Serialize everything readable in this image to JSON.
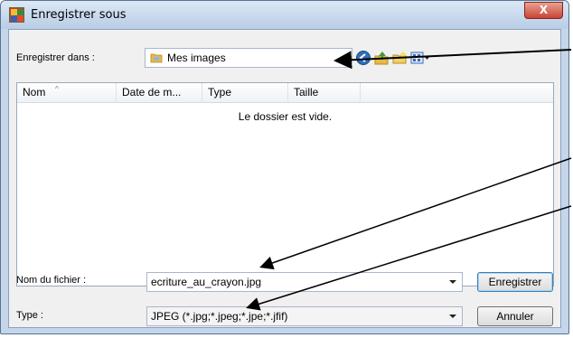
{
  "window": {
    "title": "Enregistrer sous",
    "close_label": "X"
  },
  "toolbar": {
    "save_in_label": "Enregistrer dans :",
    "location_value": "Mes images",
    "icons": [
      "back-icon",
      "up-folder-icon",
      "new-folder-icon",
      "view-menu-icon"
    ]
  },
  "file_list": {
    "columns": [
      "Nom",
      "Date de m...",
      "Type",
      "Taille"
    ],
    "empty_message": "Le dossier est vide."
  },
  "form": {
    "filename_label": "Nom du fichier :",
    "filename_value": "ecriture_au_crayon.jpg",
    "type_label": "Type :",
    "type_value": "JPEG (*.jpg;*.jpeg;*.jpe;*.jfif)",
    "save_button": "Enregistrer",
    "cancel_button": "Annuler"
  },
  "colors": {
    "title_bar": "#c5d6ea",
    "close_button": "#c74533",
    "annotation_arrow": "#000000",
    "folder": "#e8b84a"
  }
}
